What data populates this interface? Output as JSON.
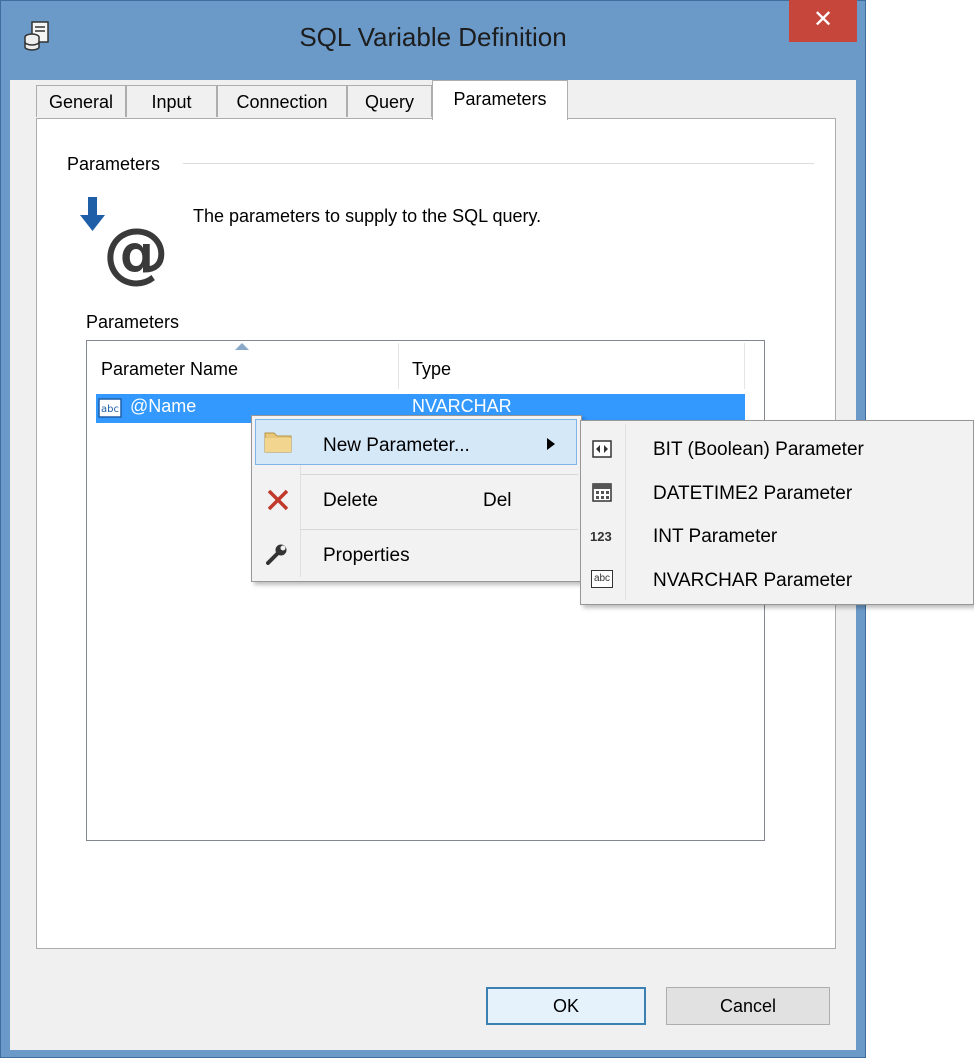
{
  "window": {
    "title": "SQL Variable Definition",
    "close_glyph": "✕"
  },
  "tabs": [
    {
      "label": "General",
      "active": false
    },
    {
      "label": "Input",
      "active": false
    },
    {
      "label": "Connection",
      "active": false
    },
    {
      "label": "Query",
      "active": false
    },
    {
      "label": "Parameters",
      "active": true
    }
  ],
  "panel": {
    "group_label": "Parameters",
    "description": "The parameters to supply to the SQL query.",
    "list_label": "Parameters",
    "icon": "parameter-at-icon"
  },
  "list": {
    "columns": [
      "Parameter Name",
      "Type"
    ],
    "rows": [
      {
        "name": "@Name",
        "type": "NVARCHAR",
        "icon": "abc-text-icon",
        "selected": true
      }
    ]
  },
  "context_menu": {
    "items": [
      {
        "label": "New Parameter...",
        "shortcut": "",
        "icon": "folder-icon",
        "has_submenu": true
      },
      {
        "label": "Delete",
        "shortcut": "Del",
        "icon": "delete-x-icon",
        "has_submenu": false
      },
      {
        "label": "Properties",
        "shortcut": "",
        "icon": "wrench-icon",
        "has_submenu": false
      }
    ]
  },
  "submenu": {
    "items": [
      {
        "label": "BIT (Boolean) Parameter",
        "icon": "boolean-icon"
      },
      {
        "label": "DATETIME2 Parameter",
        "icon": "calendar-icon"
      },
      {
        "label": "INT Parameter",
        "icon": "123-icon",
        "icon_text": "123"
      },
      {
        "label": "NVARCHAR Parameter",
        "icon": "abc-text-icon",
        "icon_text": "abc"
      }
    ]
  },
  "buttons": {
    "ok": "OK",
    "cancel": "Cancel"
  },
  "colors": {
    "frame": "#6b9ac9",
    "close": "#c7463c",
    "selection": "#3399ff",
    "menu_highlight": "#d5e8f8"
  }
}
